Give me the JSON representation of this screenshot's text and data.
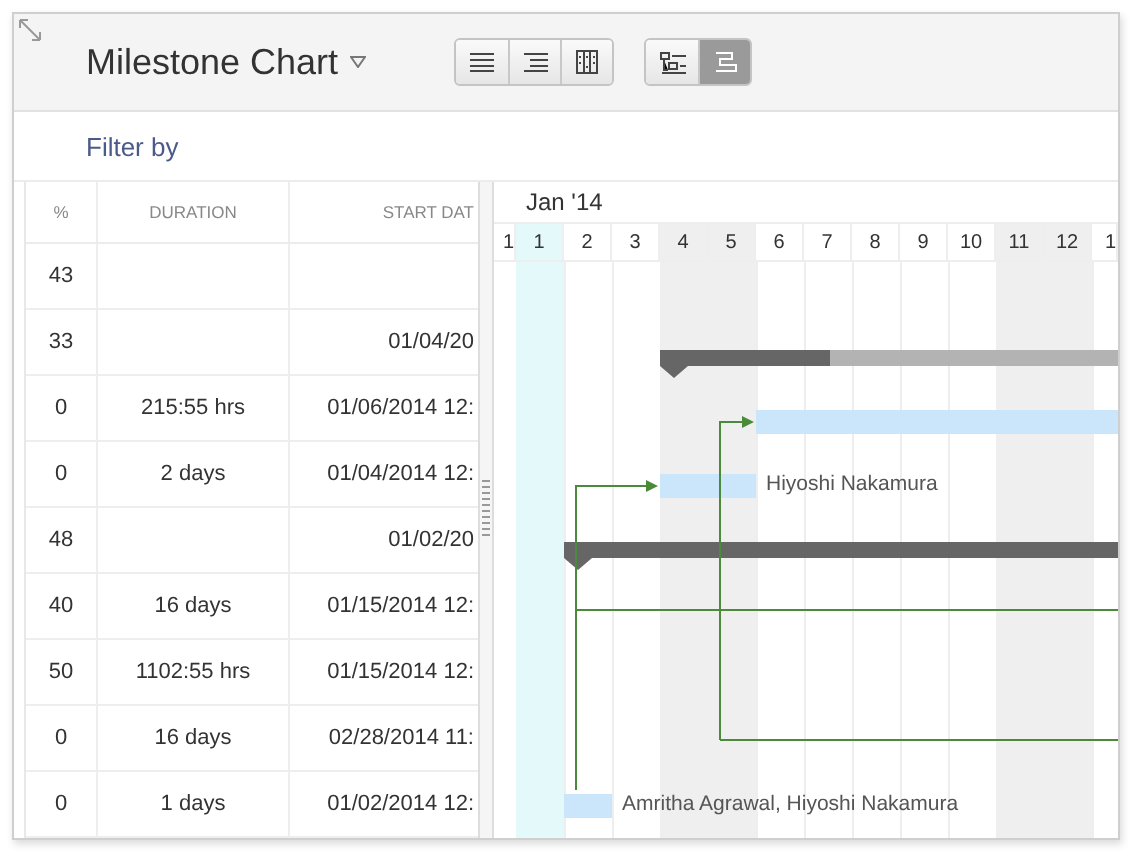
{
  "header": {
    "title": "Milestone Chart",
    "view_groups": [
      [
        {
          "kind": "lines",
          "selected": false
        },
        {
          "kind": "indent",
          "selected": false
        },
        {
          "kind": "columns",
          "selected": false
        }
      ],
      [
        {
          "kind": "tree",
          "selected": false
        },
        {
          "kind": "gantt",
          "selected": true
        }
      ]
    ]
  },
  "filter": "Filter by",
  "table": {
    "columns": [
      "%",
      "DURATION",
      "START DAT"
    ],
    "rows": [
      {
        "percent": "43"
      },
      {
        "percent": "33",
        "start": "01/04/20",
        "bar": {
          "kind": "summary",
          "level": 0.37
        }
      },
      {
        "percent": "0",
        "duration": "215:55 hrs",
        "start": "01/06/2014 12:",
        "bar": {
          "kind": "task"
        }
      },
      {
        "percent": "0",
        "duration": "2 days",
        "start": "01/04/2014 12:",
        "bar": {
          "kind": "task",
          "resources": "Hiyoshi Nakamura"
        }
      },
      {
        "percent": "48",
        "start": "01/02/20",
        "bar": {
          "kind": "summary",
          "level": 1
        }
      },
      {
        "percent": "40",
        "duration": "16 days",
        "start": "01/15/2014 12:"
      },
      {
        "percent": "50",
        "duration": "1102:55 hrs",
        "start": "01/15/2014 12:"
      },
      {
        "percent": "0",
        "duration": "16 days",
        "start": "02/28/2014 11:"
      },
      {
        "percent": "0",
        "duration": "1 days",
        "start": "01/02/2014 12:",
        "bar": {
          "kind": "task",
          "resources": "Amritha Agrawal, Hiyoshi Nakamura"
        }
      }
    ]
  },
  "timeline": {
    "month": "Jan '14",
    "days": [
      {
        "label": "1",
        "today": false,
        "weekend": false
      },
      {
        "label": "1",
        "today": true,
        "weekend": false
      },
      {
        "label": "2",
        "today": false,
        "weekend": false
      },
      {
        "label": "3",
        "today": false,
        "weekend": false
      },
      {
        "label": "4",
        "today": false,
        "weekend": true
      },
      {
        "label": "5",
        "today": false,
        "weekend": true
      },
      {
        "label": "6",
        "today": false,
        "weekend": false
      },
      {
        "label": "7",
        "today": false,
        "weekend": false
      },
      {
        "label": "8",
        "today": false,
        "weekend": false
      },
      {
        "label": "9",
        "today": false,
        "weekend": false
      },
      {
        "label": "10",
        "today": false,
        "weekend": false
      },
      {
        "label": "11",
        "today": false,
        "weekend": true
      },
      {
        "label": "12",
        "today": false,
        "weekend": true
      },
      {
        "label": "1",
        "today": false,
        "weekend": false
      }
    ]
  }
}
